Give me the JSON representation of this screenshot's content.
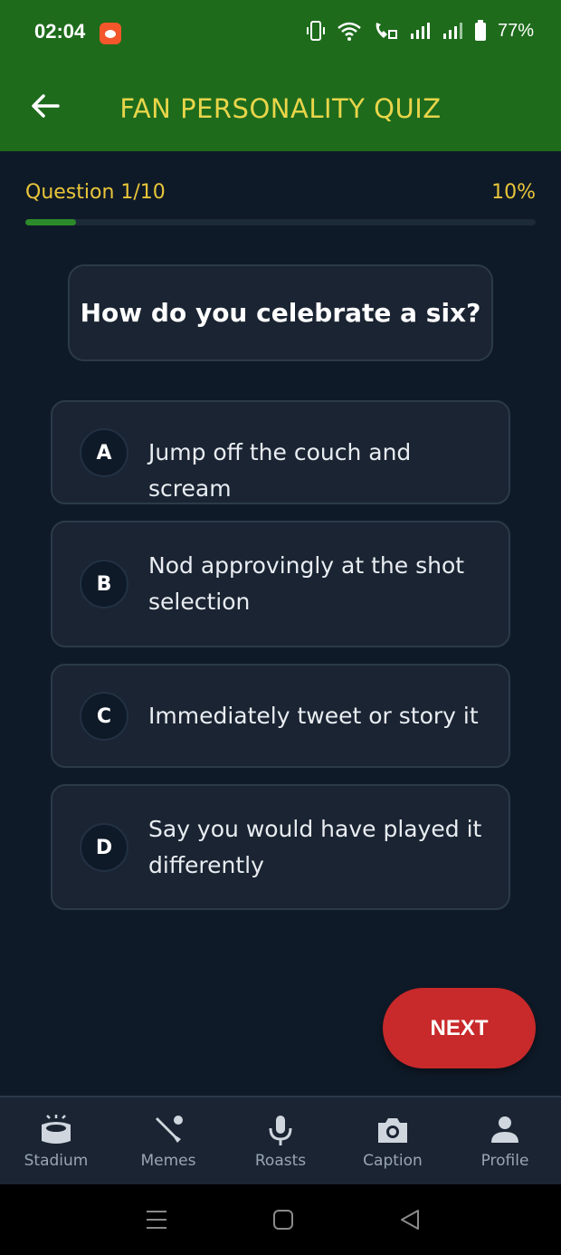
{
  "status_bar": {
    "time": "02:04",
    "battery": "77%",
    "app_icon": "reddit-icon",
    "icons": [
      "vibrate-icon",
      "wifi-icon",
      "wifi-calling-icon",
      "signal-icon",
      "signal-icon",
      "battery-icon"
    ]
  },
  "app_bar": {
    "title": "FAN PERSONALITY QUIZ",
    "back_icon": "arrow-left-icon"
  },
  "progress": {
    "label": "Question 1/10",
    "percent_text": "10%",
    "fraction": 0.1
  },
  "question": {
    "text": "How do you celebrate a six?"
  },
  "options": [
    {
      "letter": "A",
      "text": "Jump off the couch and scream"
    },
    {
      "letter": "B",
      "text": "Nod approvingly at the shot selection"
    },
    {
      "letter": "C",
      "text": "Immediately tweet or story it"
    },
    {
      "letter": "D",
      "text": "Say you would have played it differently"
    }
  ],
  "next_button": {
    "label": "NEXT"
  },
  "bottom_nav": [
    {
      "label": "Stadium",
      "icon": "stadium-icon"
    },
    {
      "label": "Memes",
      "icon": "cricket-bat-icon"
    },
    {
      "label": "Roasts",
      "icon": "microphone-icon"
    },
    {
      "label": "Caption",
      "icon": "camera-icon"
    },
    {
      "label": "Profile",
      "icon": "person-icon"
    }
  ],
  "colors": {
    "app_bar": "#1e6b1c",
    "title": "#e8d54a",
    "accent_gold": "#e8c53a",
    "progress_fill": "#2c8a2a",
    "next_button": "#c8292a",
    "background": "#0f1a28",
    "card": "#1a2432"
  }
}
